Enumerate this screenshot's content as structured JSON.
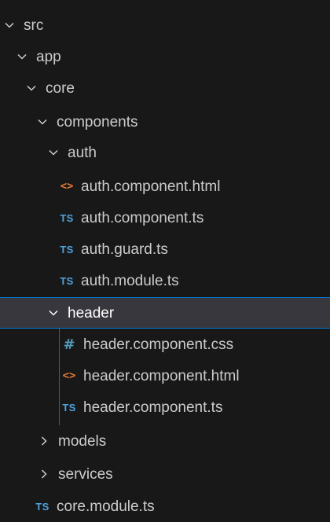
{
  "explorer": {
    "items": [
      {
        "label": "src",
        "kind": "folder",
        "state": "expanded"
      },
      {
        "label": "app",
        "kind": "folder",
        "state": "expanded"
      },
      {
        "label": "core",
        "kind": "folder",
        "state": "expanded"
      },
      {
        "label": "components",
        "kind": "folder",
        "state": "expanded"
      },
      {
        "label": "auth",
        "kind": "folder",
        "state": "expanded"
      },
      {
        "label": "auth.component.html",
        "kind": "file",
        "icon": "html-icon",
        "icon_text": "<>"
      },
      {
        "label": "auth.component.ts",
        "kind": "file",
        "icon": "typescript-icon",
        "icon_text": "TS"
      },
      {
        "label": "auth.guard.ts",
        "kind": "file",
        "icon": "typescript-icon",
        "icon_text": "TS"
      },
      {
        "label": "auth.module.ts",
        "kind": "file",
        "icon": "typescript-icon",
        "icon_text": "TS"
      },
      {
        "label": "header",
        "kind": "folder",
        "state": "expanded",
        "selected": true
      },
      {
        "label": "header.component.css",
        "kind": "file",
        "icon": "css-icon",
        "icon_text": "#"
      },
      {
        "label": "header.component.html",
        "kind": "file",
        "icon": "html-icon",
        "icon_text": "<>"
      },
      {
        "label": "header.component.ts",
        "kind": "file",
        "icon": "typescript-icon",
        "icon_text": "TS"
      },
      {
        "label": "models",
        "kind": "folder",
        "state": "collapsed"
      },
      {
        "label": "services",
        "kind": "folder",
        "state": "collapsed"
      },
      {
        "label": "core.module.ts",
        "kind": "file",
        "icon": "typescript-icon",
        "icon_text": "TS"
      }
    ]
  },
  "colors": {
    "background": "#181818",
    "text": "#cccccc",
    "selection_background": "#37373d",
    "selection_border": "#0078d4",
    "typescript": "#4ca3df",
    "html": "#e37933",
    "css": "#519aba"
  }
}
